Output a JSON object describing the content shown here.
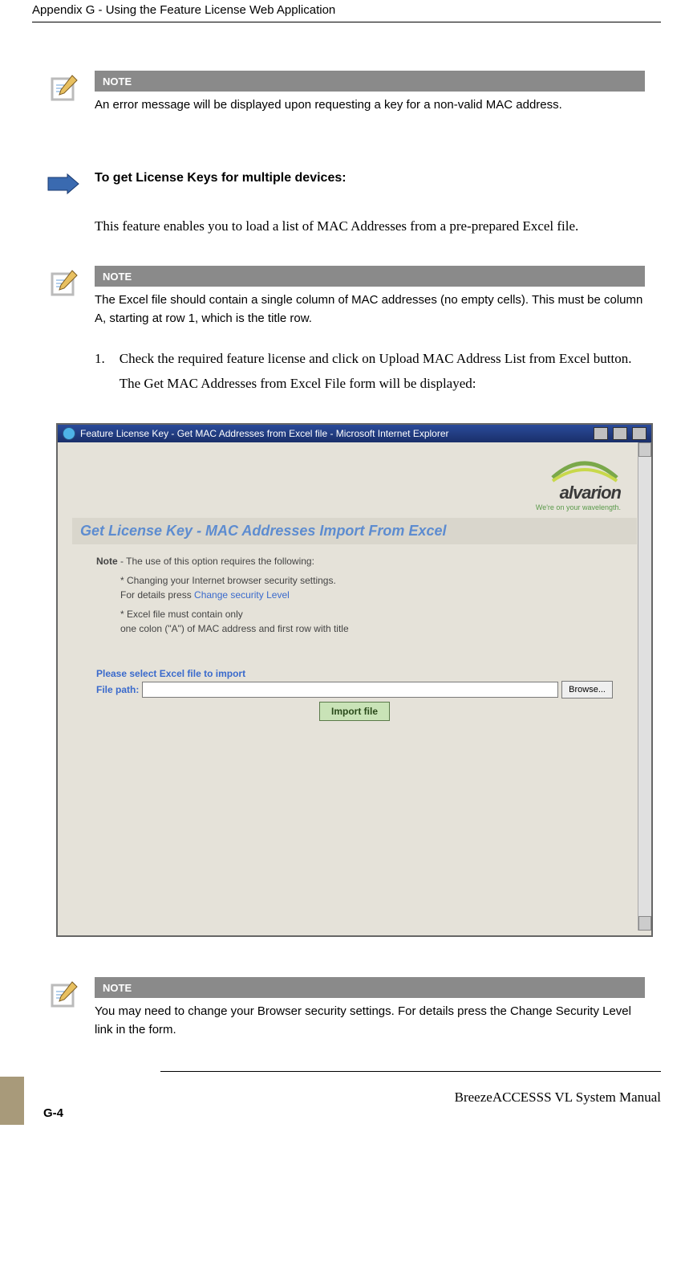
{
  "header": {
    "title": "Appendix G - Using the Feature License Web Application"
  },
  "note1": {
    "label": "NOTE",
    "text": "An error message will be displayed upon requesting a key for a non-valid MAC address."
  },
  "section": {
    "heading": "To get License Keys for multiple devices:"
  },
  "para1": "This feature enables you to load a list of MAC Addresses from a pre-prepared Excel file.",
  "note2": {
    "label": "NOTE",
    "text": "The Excel file should contain a single column of MAC addresses (no empty cells). This must be column A, starting at row 1, which is the title row."
  },
  "step1": {
    "num": "1.",
    "text": "Check the required feature license and click on Upload MAC Address List from Excel button. The Get MAC Addresses from Excel File form will be displayed:"
  },
  "screenshot": {
    "window_title": "Feature License Key - Get MAC Addresses from Excel file - Microsoft Internet Explorer",
    "logo_text": "alvarion",
    "logo_tag": "We're on your wavelength.",
    "page_heading": "Get License Key - MAC Addresses Import From Excel",
    "note_label": "Note",
    "note_intro": " - The use of this option requires the following:",
    "bullet1a": "Changing your Internet browser security settings.",
    "bullet1b": "For details press ",
    "bullet1_link": "Change security Level",
    "bullet2a": "Excel file must contain only",
    "bullet2b": "one colon (\"A\") of MAC address and first row with title",
    "select_label": "Please select Excel file to import",
    "file_label": "File path:",
    "browse_label": "Browse...",
    "import_label": "Import file"
  },
  "note3": {
    "label": "NOTE",
    "text": "You may need to change your Browser security settings. For details press the Change Security Level link in the form."
  },
  "footer": {
    "manual": "BreezeACCESSS VL System Manual",
    "pagenum": "G-4"
  }
}
